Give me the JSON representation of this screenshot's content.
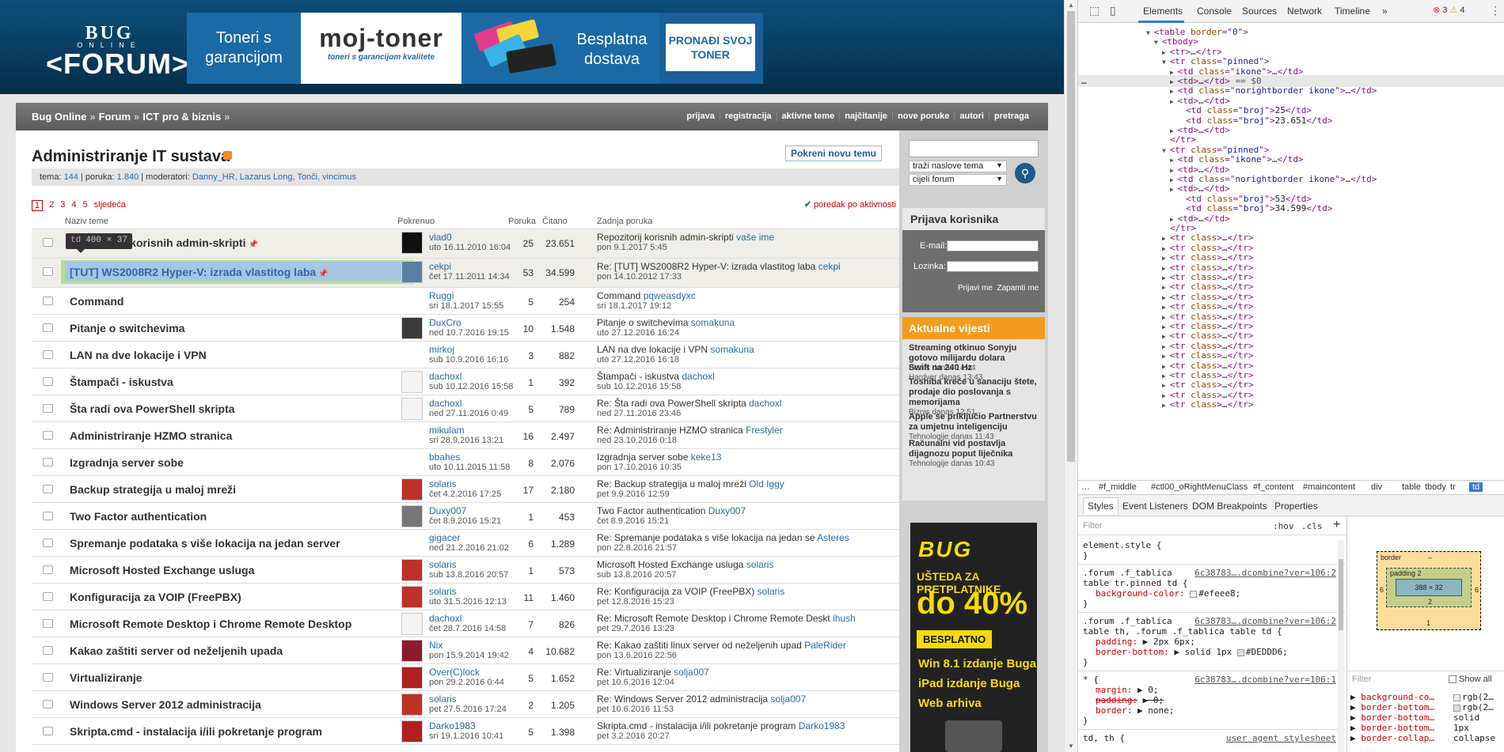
{
  "site": {
    "logo_line1": "BUG",
    "logo_line2": "ONLINE",
    "logo_line3": "<FORUM>",
    "banner": {
      "left_text": "Toneri s garancijom",
      "brand": "moj-toner",
      "brand_tagline": "toneri s garancijom kvalitete",
      "delivery_text": "Besplatna dostava",
      "cta": "PRONAĐI SVOJ TONER"
    }
  },
  "breadcrumb": [
    "Bug Online",
    "Forum",
    "ICT pro & biznis"
  ],
  "breadcrumb_sep": "»",
  "topnav": [
    "prijava",
    "registracija",
    "aktivne teme",
    "najčitanije",
    "nove poruke",
    "autori",
    "pretraga"
  ],
  "forum": {
    "title": "Administriranje IT sustava",
    "new_topic": "Pokreni novu temu",
    "meta_prefix_topics": "tema:",
    "topics_count": "144",
    "meta_prefix_posts": "| poruka:",
    "posts_count": "1.840",
    "meta_prefix_mods": "| moderatori:",
    "moderators": "Danny_HR, Lazarus Long, Tonči, vincimus",
    "pages": [
      "1",
      "2",
      "3",
      "4",
      "5"
    ],
    "next_label": "sljedeća",
    "sort_label": "poredak po aktivnosti"
  },
  "table_head": {
    "name": "Naziv teme",
    "starter": "Pokrenuo",
    "posts": "Poruka",
    "reads": "Čitano",
    "last": "Zadnja poruka"
  },
  "topics": [
    {
      "title": "Repozitorij korisnih admin-skripti",
      "pinned": true,
      "author": "vlad0",
      "date": "uto 16.11.2010 16:04",
      "posts": "25",
      "reads": "23.651",
      "last": "Repozitorij korisnih admin-skripti",
      "last_user": "vaše ime",
      "last_date": "pon 9.1.2017 5:45",
      "avatar": "#111"
    },
    {
      "title": "[TUT] WS2008R2 Hyper-V: izrada vlastitog laba",
      "pinned": true,
      "selected": true,
      "author": "cekpi",
      "date": "čet 17.11.2011 14:34",
      "posts": "53",
      "reads": "34.599",
      "last": "Re: [TUT] WS2008R2 Hyper-V: izrada vlastitog laba",
      "last_user": "cekpi",
      "last_date": "pon 14.10.2012 17:33",
      "avatar": "#5a7fa0"
    },
    {
      "title": "Command",
      "author": "Ruggi",
      "date": "sri 18.1.2017 15:55",
      "posts": "5",
      "reads": "254",
      "last": "Command",
      "last_user": "pqweasdyxc",
      "last_date": "sri 18.1.2017 19:12",
      "avatar": ""
    },
    {
      "title": "Pitanje o switchevima",
      "author": "DuxCro",
      "date": "ned 10.7.2016 19:15",
      "posts": "10",
      "reads": "1.548",
      "last": "Pitanje o switchevima",
      "last_user": "somakuna",
      "last_date": "uto 27.12.2016 16:24",
      "avatar": "#3a3a3a"
    },
    {
      "title": "LAN na dve lokacije i VPN",
      "author": "mirkoj",
      "date": "sub 10.9.2016 16:16",
      "posts": "3",
      "reads": "882",
      "last": "LAN na dve lokacije i VPN",
      "last_user": "somakuna",
      "last_date": "uto 27.12.2016 16:18",
      "avatar": ""
    },
    {
      "title": "Štampači - iskustva",
      "author": "dachoxl",
      "date": "sub 10.12.2016 15:58",
      "posts": "1",
      "reads": "392",
      "last": "Štampači - iskustva",
      "last_user": "dachoxl",
      "last_date": "sub 10.12.2016 15:58",
      "avatar": "#f4f4f4"
    },
    {
      "title": "Šta radi ova PowerShell skripta",
      "author": "dachoxl",
      "date": "ned 27.11.2016 0:49",
      "posts": "5",
      "reads": "789",
      "last": "Re: Šta radi ova PowerShell skripta",
      "last_user": "dachoxl",
      "last_date": "ned 27.11.2016 23:46",
      "avatar": "#f4f4f4"
    },
    {
      "title": "Administriranje HZMO stranica",
      "author": "mikulam",
      "date": "sri 28.9.2016 13:21",
      "posts": "16",
      "reads": "2.497",
      "last": "Re: Administriranje HZMO stranica",
      "last_user": "Frestyler",
      "last_date": "ned 23.10.2016 0:18",
      "avatar": ""
    },
    {
      "title": "Izgradnja server sobe",
      "author": "bbahes",
      "date": "uto 10.11.2015 11:58",
      "posts": "8",
      "reads": "2.076",
      "last": "Izgradnja server sobe",
      "last_user": "keke13",
      "last_date": "pon 17.10.2016 10:35",
      "avatar": ""
    },
    {
      "title": "Backup strategija u maloj mreži",
      "author": "solaris",
      "date": "čet 4.2.2016 17:25",
      "posts": "17",
      "reads": "2.180",
      "last": "Re: Backup strategija u maloj mreži",
      "last_user": "Old Iggy",
      "last_date": "pet 9.9.2016 12:59",
      "avatar": "#c0302a"
    },
    {
      "title": "Two Factor authentication",
      "author": "Duxy007",
      "date": "čet 8.9.2016 15:21",
      "posts": "1",
      "reads": "453",
      "last": "Two Factor authentication",
      "last_user": "Duxy007",
      "last_date": "čet 8.9.2016 15:21",
      "avatar": "#777"
    },
    {
      "title": "Spremanje podataka s više lokacija na jedan server",
      "author": "gigacer",
      "date": "ned 21.2.2016 21:02",
      "posts": "6",
      "reads": "1.289",
      "last": "Re: Spremanje podataka s više lokacija na jedan se",
      "last_user": "Asteres",
      "last_date": "pon 22.8.2016 21:57",
      "avatar": ""
    },
    {
      "title": "Microsoft Hosted Exchange usluga",
      "author": "solaris",
      "date": "sub 13.8.2016 20:57",
      "posts": "1",
      "reads": "573",
      "last": "Microsoft Hosted Exchange usluga",
      "last_user": "solaris",
      "last_date": "sub 13.8.2016 20:57",
      "avatar": "#c0302a"
    },
    {
      "title": "Konfiguracija za VOIP (FreePBX)",
      "author": "solaris",
      "date": "uto 31.5.2016 12:13",
      "posts": "11",
      "reads": "1.460",
      "last": "Re: Konfiguracija za VOIP (FreePBX)",
      "last_user": "solaris",
      "last_date": "pet 12.8.2016 15:23",
      "avatar": "#c0302a"
    },
    {
      "title": "Microsoft Remote Desktop i Chrome Remote Desktop",
      "author": "dachoxl",
      "date": "čet 28.7.2016 14:58",
      "posts": "7",
      "reads": "826",
      "last": "Re: Microsoft Remote Desktop i Chrome Remote Deskt",
      "last_user": "ihush",
      "last_date": "pet 29.7.2016 13:23",
      "avatar": "#f4f4f4"
    },
    {
      "title": "Kakao zaštiti server od neželjenih upada",
      "author": "Nix",
      "date": "pon 15.9.2014 19:42",
      "posts": "4",
      "reads": "10.682",
      "last": "Re: Kakao zaštiti linux server od neželjenih upad",
      "last_user": "PaleRider",
      "last_date": "pon 13.6.2016 22:56",
      "avatar": "#8b1a2a"
    },
    {
      "title": "Virtualiziranje",
      "author": "Over(C)lock",
      "date": "pon 29.2.2016 0:44",
      "posts": "5",
      "reads": "1.652",
      "last": "Re: Virtualiziranje",
      "last_user": "solja007",
      "last_date": "pet 10.6.2016 12:04",
      "avatar": "#b02020"
    },
    {
      "title": "Windows Server 2012 administracija",
      "author": "solaris",
      "date": "pet 27.5.2016 17:24",
      "posts": "2",
      "reads": "1.205",
      "last": "Re: Windows Server 2012 administracija",
      "last_user": "solja007",
      "last_date": "pet 10.6.2016 11:53",
      "avatar": "#c0302a"
    },
    {
      "title": "Skripta.cmd - instalacija i/ili pokretanje program",
      "author": "Darko1983",
      "date": "sri 19.1.2016 10:41",
      "posts": "5",
      "reads": "1.398",
      "last": "Skripta.cmd - instalacija i/ili pokretanje program",
      "last_user": "Darko1983",
      "last_date": "pet 3.2.2016 20:27",
      "avatar": "#b02020"
    }
  ],
  "tooltip": {
    "tag": "td",
    "dims": "400 × 37"
  },
  "sidebar": {
    "search_sel1": "traži naslove tema",
    "search_sel2": "cijeli forum",
    "login_title": "Prijava korisnika",
    "email_label": "E-mail:",
    "pass_label": "Lozinka:",
    "remember": "Prijavi me",
    "remember2": "Zapamti me",
    "news_title": "Aktualne vijesti",
    "news": [
      {
        "title": "Streaming otkinuo Sonyju gotovo milijardu dolara",
        "cat": "Biznis",
        "time": "danas 14:44"
      },
      {
        "title": "Swift na 240 Hz",
        "cat": "Hardver",
        "time": "danas 13:43"
      },
      {
        "title": "Toshiba kreće u sanaciju štete, prodaje dio poslovanja s memorijama",
        "cat": "Biznis",
        "time": "danas 12:51"
      },
      {
        "title": "Apple se priključio Partnerstvu za umjetnu inteligenciju",
        "cat": "Tehnologije",
        "time": "danas 11:43"
      },
      {
        "title": "Računalni vid postavlja dijagnozu poput liječnika",
        "cat": "Tehnologije",
        "time": "danas 10:43"
      }
    ],
    "ad": {
      "logo": "BUG",
      "line1": "UŠTEDA ZA PRETPLATNIKE",
      "line2": "do 40%",
      "badge": "BESPLATNO",
      "items": [
        "Win 8.1 izdanje Buga",
        "iPad izdanje Buga",
        "Web arhiva"
      ]
    }
  },
  "devtools": {
    "tabs": [
      "Elements",
      "Console",
      "Sources",
      "Network",
      "Timeline"
    ],
    "errors": "3",
    "warnings": "4",
    "dom_lines": [
      "<table border=\"0\">",
      "<tbody>",
      "<tr>…</tr>",
      "<tr class=\"pinned\">",
      "<td class=\"ikone\">…</td>",
      "<td>…</td> == $0",
      "<td class=\"norightborder ikone\">…</td>",
      "<td>…</td>",
      "<td class=\"broj\">25</td>",
      "<td class=\"broj\">23.651</td>",
      "<td>…</td>",
      "</tr>",
      "<tr class=\"pinned\">",
      "<td class=\"ikone\">…</td>",
      "<td>…</td>",
      "<td class=\"norightborder ikone\">…</td>",
      "<td>…</td>",
      "<td class=\"broj\">53</td>",
      "<td class=\"broj\">34.599</td>",
      "<td>…</td>",
      "</tr>"
    ],
    "collapsed_tr": "<tr class>…</tr>",
    "crumbs": [
      "…",
      "#f_middle",
      "#ctl00_oRightMenuClass",
      "#f_content",
      "#maincontent",
      "div",
      "table",
      "tbody",
      "tr",
      "td"
    ],
    "subtabs": [
      "Styles",
      "Event Listeners",
      "DOM Breakpoints",
      "Properties"
    ],
    "filter_placeholder": "Filter",
    "hov": ":hov",
    "cls": ".cls",
    "styles": [
      {
        "sel": "element.style {",
        "src": ""
      },
      {
        "sel": "}",
        "src": ""
      },
      {
        "sel": ".forum .f_tablica",
        "src": "6c38783….dcombine?ver=106:2"
      },
      {
        "sel": "table tr.pinned td {",
        "src": ""
      },
      {
        "prop": "background-color:",
        "val": "#efeee8;",
        "swatch": "#efeee8"
      },
      {
        "sel": "}",
        "src": ""
      },
      {
        "sel": ".forum .f_tablica",
        "src": "6c38783….dcombine?ver=106:2"
      },
      {
        "sel": "table th, .forum .f_tablica table td {",
        "src": ""
      },
      {
        "prop": "padding:",
        "val": "▶ 2px 6px;"
      },
      {
        "prop": "border-bottom:",
        "val": "▶ solid 1px ",
        "swatch": "#DEDDD6",
        "val2": "#DEDDD6;"
      },
      {
        "sel": "}",
        "src": ""
      },
      {
        "sel": "* {",
        "src": "6c38783….dcombine?ver=106:1"
      },
      {
        "prop": "margin:",
        "val": "▶ 0;"
      },
      {
        "prop": "padding:",
        "val": "▶ 0;",
        "strike": true
      },
      {
        "prop": "border:",
        "val": "▶ none;"
      },
      {
        "sel": "}",
        "src": ""
      },
      {
        "sel": "td, th {",
        "src": "user agent stylesheet"
      }
    ],
    "box_model": {
      "border": "border",
      "border_val": "–",
      "padding": "padding 2",
      "content": "388 × 32",
      "left": "6",
      "right": "6",
      "bottom_pad": "2",
      "bottom": "1"
    },
    "computed_filter": "Filter",
    "show_all": "Show all",
    "computed": [
      {
        "prop": "background-co…",
        "val": "rgb(2…",
        "swatch": "#efeee8"
      },
      {
        "prop": "border-bottom…",
        "val": "rgb(2…",
        "swatch": "#dedddd"
      },
      {
        "prop": "border-bottom…",
        "val": "solid"
      },
      {
        "prop": "border-bottom…",
        "val": "1px"
      },
      {
        "prop": "border-collap…",
        "val": "collapse"
      }
    ]
  }
}
